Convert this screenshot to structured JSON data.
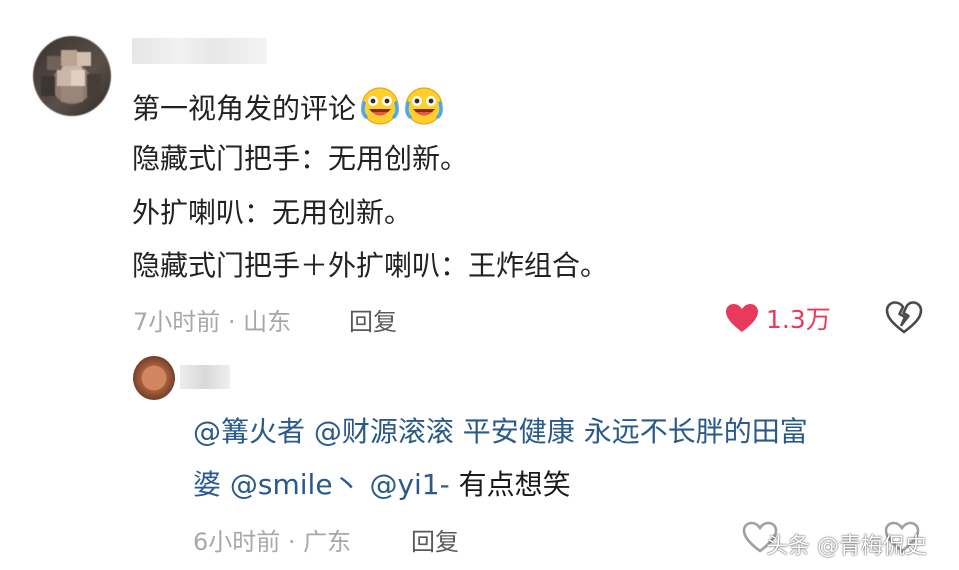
{
  "comment": {
    "lines": [
      "第一视角发的评论",
      "隐藏式门把手：无用创新。",
      "外扩喇叭：无用创新。",
      "隐藏式门把手＋外扩喇叭：王炸组合。"
    ],
    "emoji_icons": [
      "laugh-cry-emoji-icon",
      "laugh-cry-emoji-icon"
    ],
    "time_location": "7小时前 · 山东",
    "reply_label": "回复",
    "like_count": "1.3万",
    "like_color": "#ea3a5c"
  },
  "reply": {
    "mentions_line1": "@篝火者 @财源滚滚 平安健康 永远不长胖的田富",
    "line2_mentions": "婆 @smile丶 @yi1-",
    "line2_text": " 有点想笑",
    "time_location": "6小时前 · 广东",
    "reply_label": "回复",
    "mention_color": "#2a5a8a"
  },
  "watermark": "头条 @青梅侃史"
}
